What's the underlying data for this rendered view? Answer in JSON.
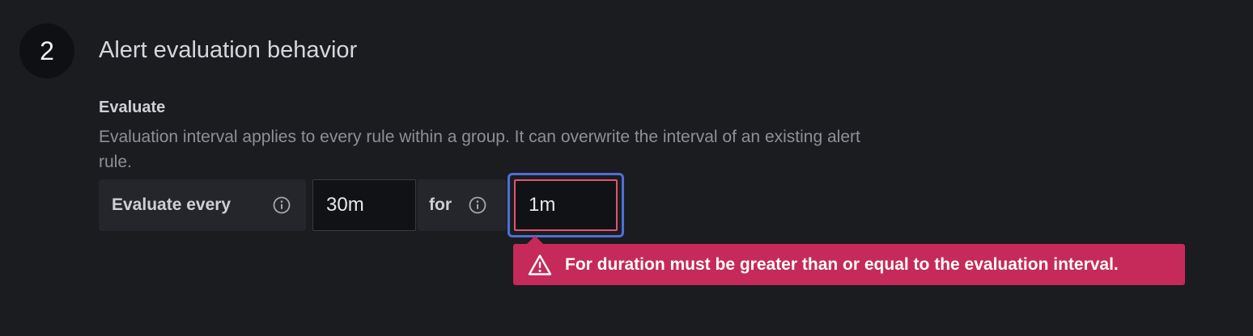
{
  "step": {
    "number": "2",
    "title": "Alert evaluation behavior"
  },
  "evaluate": {
    "label": "Evaluate",
    "description": "Evaluation interval applies to every rule within a group. It can overwrite the interval of an existing alert rule.",
    "every_label": "Evaluate every",
    "every_value": "30m",
    "for_label": "for",
    "for_value": "1m"
  },
  "error": {
    "message": "For duration must be greater than or equal to the evaluation interval."
  },
  "colors": {
    "background": "#1b1c20",
    "error": "#c52a5a",
    "focus": "#4f6fd4",
    "invalid_border": "#e0556c"
  },
  "icons": {
    "info": "info-circle-icon",
    "warning": "warning-triangle-icon"
  }
}
